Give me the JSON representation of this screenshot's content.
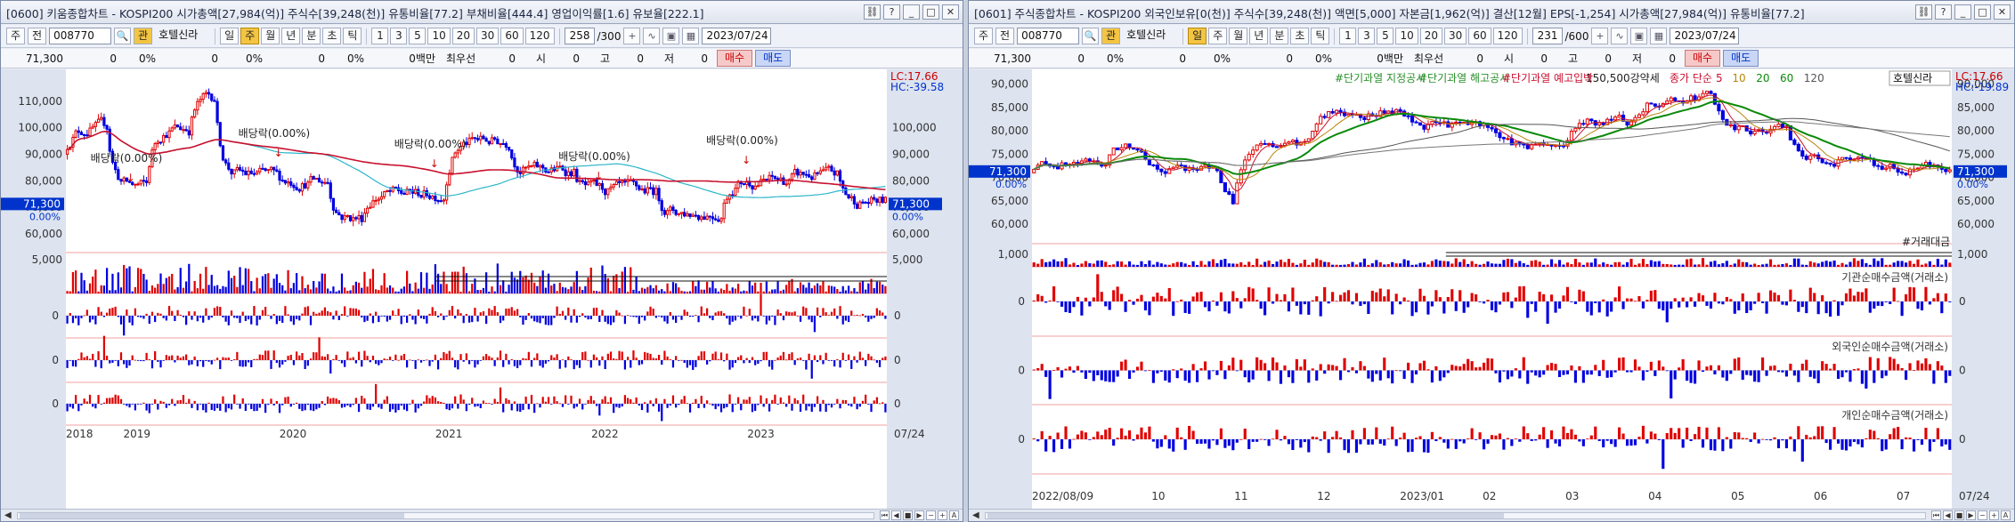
{
  "colors": {
    "up": "#e00000",
    "down": "#0000e0",
    "ma_red": "#c8102e",
    "ma_cyan": "#2bb5c9",
    "ma_green": "#0a8a0a",
    "ma_gray": "#555555",
    "price_tag": "#0033cc"
  },
  "left": {
    "title": "[0600] 키움종합차트 - KOSPI200 시가총액[27,984(억)] 주식수[39,248(천)] 유통비율[77.2] 부채비율[444.4] 영업이익률[1.6] 유보율[222.1]",
    "toolbar": {
      "prefix": "주",
      "mode": "전",
      "code": "008770",
      "stock_name": "호텔신라",
      "periods": [
        "일",
        "주",
        "월",
        "년",
        "분",
        "초",
        "틱"
      ],
      "selected_period": "주",
      "intervals": [
        "1",
        "3",
        "5",
        "10",
        "20",
        "30",
        "60",
        "120"
      ],
      "count": "258",
      "count_total": "/300",
      "date": "2023/07/24"
    },
    "hoga": {
      "price": "71,300",
      "chg": "0",
      "pct": "0%",
      "v1": "0",
      "p1": "0%",
      "v2": "0",
      "p2": "0%",
      "vol": "0백만",
      "pri": "최우선",
      "v3": "0",
      "o_label": "시",
      "o": "0",
      "h_label": "고",
      "h": "0",
      "l_label": "저",
      "l": "0",
      "buy": "매수",
      "sell": "매도"
    },
    "price_axis": [
      "110,000",
      "100,000",
      "90,000",
      "80,000",
      "70,000",
      "60,000"
    ],
    "price_axis_right": [
      "100,000",
      "90,000",
      "80,000",
      "70,000",
      "60,000"
    ],
    "lc": "LC:17.66",
    "hc": "HC:-39.58",
    "last_price": "71,300",
    "last_pct": "0.00%",
    "annotations": [
      "배당락(0.00%)",
      "배당락(0.00%)",
      "배당락(0.00%)",
      "배당락(0.00%)",
      "배당락(0.00%)"
    ],
    "vol_axis": "5,000",
    "vol_axis_right": "5,000",
    "zero": "0",
    "xaxis": [
      "2018",
      "2019",
      "2020",
      "2021",
      "2022",
      "2023",
      "07/24"
    ]
  },
  "right": {
    "title": "[0601] 주식종합차트 - KOSPI200 외국인보유[0(천)] 주식수[39,248(천)] 액면[5,000] 자본금[1,962(억)] 결산[12월] EPS[-1,254] 시가총액[27,984(억)] 유통비율[77.2]",
    "toolbar": {
      "prefix": "주",
      "mode": "전",
      "code": "008770",
      "stock_name": "호텔신라",
      "periods": [
        "일",
        "주",
        "월",
        "년",
        "분",
        "초",
        "틱"
      ],
      "selected_period": "일",
      "intervals": [
        "1",
        "3",
        "5",
        "10",
        "20",
        "30",
        "60",
        "120"
      ],
      "count": "231",
      "count_total": "/600",
      "date": "2023/07/24"
    },
    "hoga": {
      "price": "71,300",
      "chg": "0",
      "pct": "0%",
      "v1": "0",
      "p1": "0%",
      "v2": "0",
      "p2": "0%",
      "vol": "0백만",
      "pri": "최우선",
      "v3": "0",
      "o_label": "시",
      "o": "0",
      "h_label": "고",
      "h": "0",
      "l_label": "저",
      "l": "0",
      "buy": "매수",
      "sell": "매도"
    },
    "legend": [
      {
        "text": "#단기과열 지정공시",
        "color": "#2a8f2a"
      },
      {
        "text": "#단기과열 해고공시",
        "color": "#2a8f2a"
      },
      {
        "text": "#단기과열 예고입박",
        "color": "#c8102e"
      },
      {
        "text": "150,500강약세",
        "color": "#222222"
      },
      {
        "text": "종가 단순",
        "color": "#c8102e"
      },
      {
        "text": "5",
        "color": "#c8102e"
      },
      {
        "text": "10",
        "color": "#b8860b"
      },
      {
        "text": "20",
        "color": "#0a8a0a"
      },
      {
        "text": "60",
        "color": "#0a8a0a"
      },
      {
        "text": "120",
        "color": "#555555"
      }
    ],
    "stock_tag": "호텔신라",
    "price_axis": [
      "90,000",
      "85,000",
      "80,000",
      "75,000",
      "70,000",
      "65,000",
      "60,000"
    ],
    "price_axis_right": [
      "90,000",
      "85,000",
      "80,000",
      "75,000",
      "70,000",
      "65,000",
      "60,000"
    ],
    "lc": "LC:17.66",
    "hc": "HC:-19.89",
    "last_price": "71,300",
    "last_pct": "0.00%",
    "vol_title": "#거래대금",
    "vol_axis": "1,000",
    "vol_axis_right": "1,000",
    "panels": [
      "기관순매수금액(거래소)",
      "외국인순매수금액(거래소)",
      "개인순매수금액(거래소)"
    ],
    "zero": "0",
    "xaxis": [
      "2022/08/09",
      "10",
      "11",
      "12",
      "2023/01",
      "02",
      "03",
      "04",
      "05",
      "06",
      "07",
      "07/24"
    ]
  }
}
